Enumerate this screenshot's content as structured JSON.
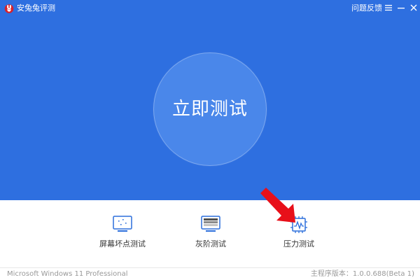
{
  "app": {
    "title": "安兔兔评测",
    "logo_icon": "rabbit-logo-icon"
  },
  "titlebar": {
    "feedback_label": "问题反馈",
    "icons": [
      "menu-icon",
      "minimize-icon",
      "close-icon"
    ]
  },
  "main": {
    "start_label": "立即测试"
  },
  "tools": [
    {
      "label": "屏幕坏点测试",
      "icon": "monitor-dots-icon"
    },
    {
      "label": "灰阶测试",
      "icon": "grayscale-monitor-icon"
    },
    {
      "label": "压力测试",
      "icon": "chip-pulse-icon"
    }
  ],
  "annotation": {
    "arrow_color": "#e8101a",
    "points_to": "压力测试"
  },
  "statusbar": {
    "os": "Microsoft Windows 11 Professional",
    "version": "主程序版本：1.0.0.688(Beta 1)"
  },
  "colors": {
    "header_blue": "#2e6fe0",
    "button_blue": "#4a87ea",
    "icon_blue": "#2c6fdc"
  }
}
